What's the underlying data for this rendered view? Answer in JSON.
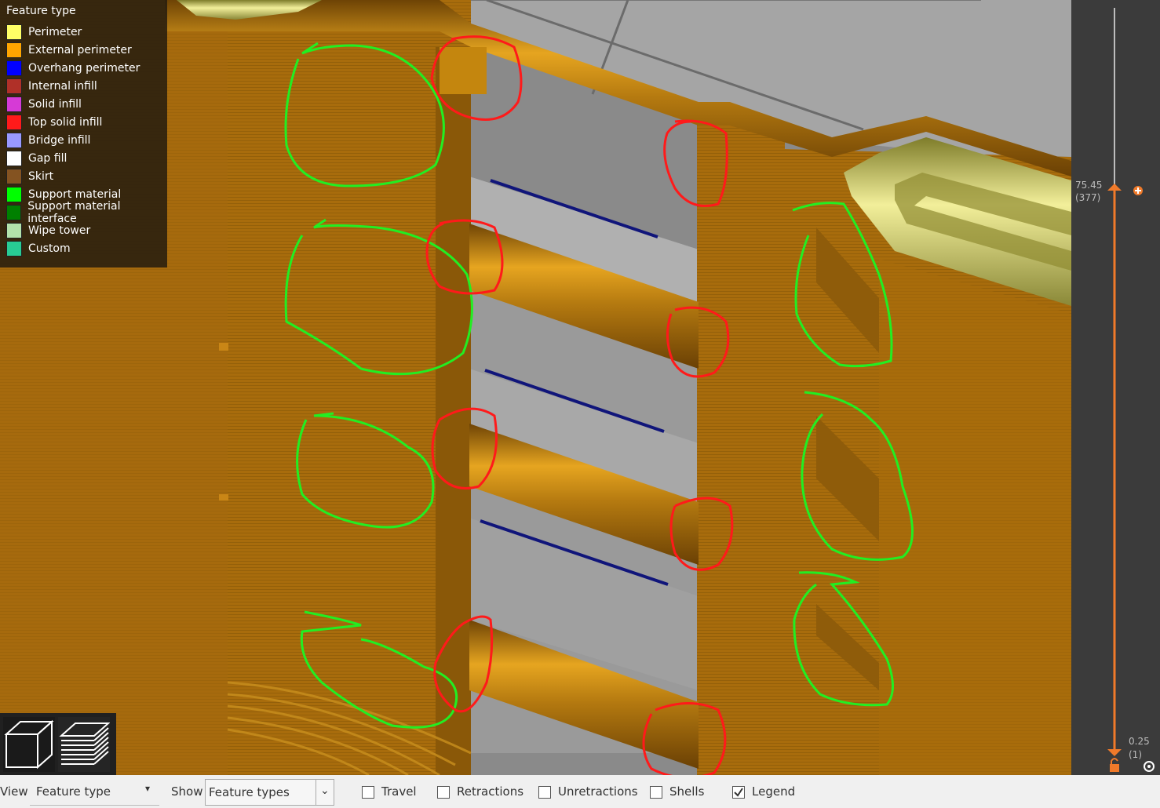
{
  "legend": {
    "title": "Feature type",
    "items": [
      {
        "label": "Perimeter",
        "color": "#ffff66"
      },
      {
        "label": "External perimeter",
        "color": "#ffa500"
      },
      {
        "label": "Overhang perimeter",
        "color": "#0000ff"
      },
      {
        "label": "Internal infill",
        "color": "#b03028"
      },
      {
        "label": "Solid infill",
        "color": "#d63ad6"
      },
      {
        "label": "Top solid infill",
        "color": "#ff1a1a"
      },
      {
        "label": "Bridge infill",
        "color": "#9999ff"
      },
      {
        "label": "Gap fill",
        "color": "#ffffff"
      },
      {
        "label": "Skirt",
        "color": "#845321"
      },
      {
        "label": "Support material",
        "color": "#00ff00"
      },
      {
        "label": "Support material interface",
        "color": "#008000"
      },
      {
        "label": "Wipe tower",
        "color": "#b3e3ab"
      },
      {
        "label": "Custom",
        "color": "#28cc94"
      }
    ]
  },
  "view_buttons": {
    "iso_icon": "cube-iso-icon",
    "layers_icon": "layers-stack-icon"
  },
  "slider": {
    "top_value": "75.45",
    "top_layer": "(377)",
    "bottom_value": "0.25",
    "bottom_layer": "(1)",
    "accent": "#f07a2a",
    "add_icon": "plus-circle-icon",
    "lock_icon": "lock-open-icon",
    "settings_icon": "cog-icon"
  },
  "bottom_bar": {
    "view_label": "View",
    "view_value": "Feature type",
    "show_label": "Show",
    "show_value": "Feature types",
    "checkboxes": [
      {
        "label": "Travel",
        "checked": false
      },
      {
        "label": "Retractions",
        "checked": false
      },
      {
        "label": "Unretractions",
        "checked": false
      },
      {
        "label": "Shells",
        "checked": false
      },
      {
        "label": "Legend",
        "checked": true
      }
    ]
  },
  "annotations": {
    "green_marks": "#22ee22",
    "red_marks": "#ff1a1a"
  }
}
